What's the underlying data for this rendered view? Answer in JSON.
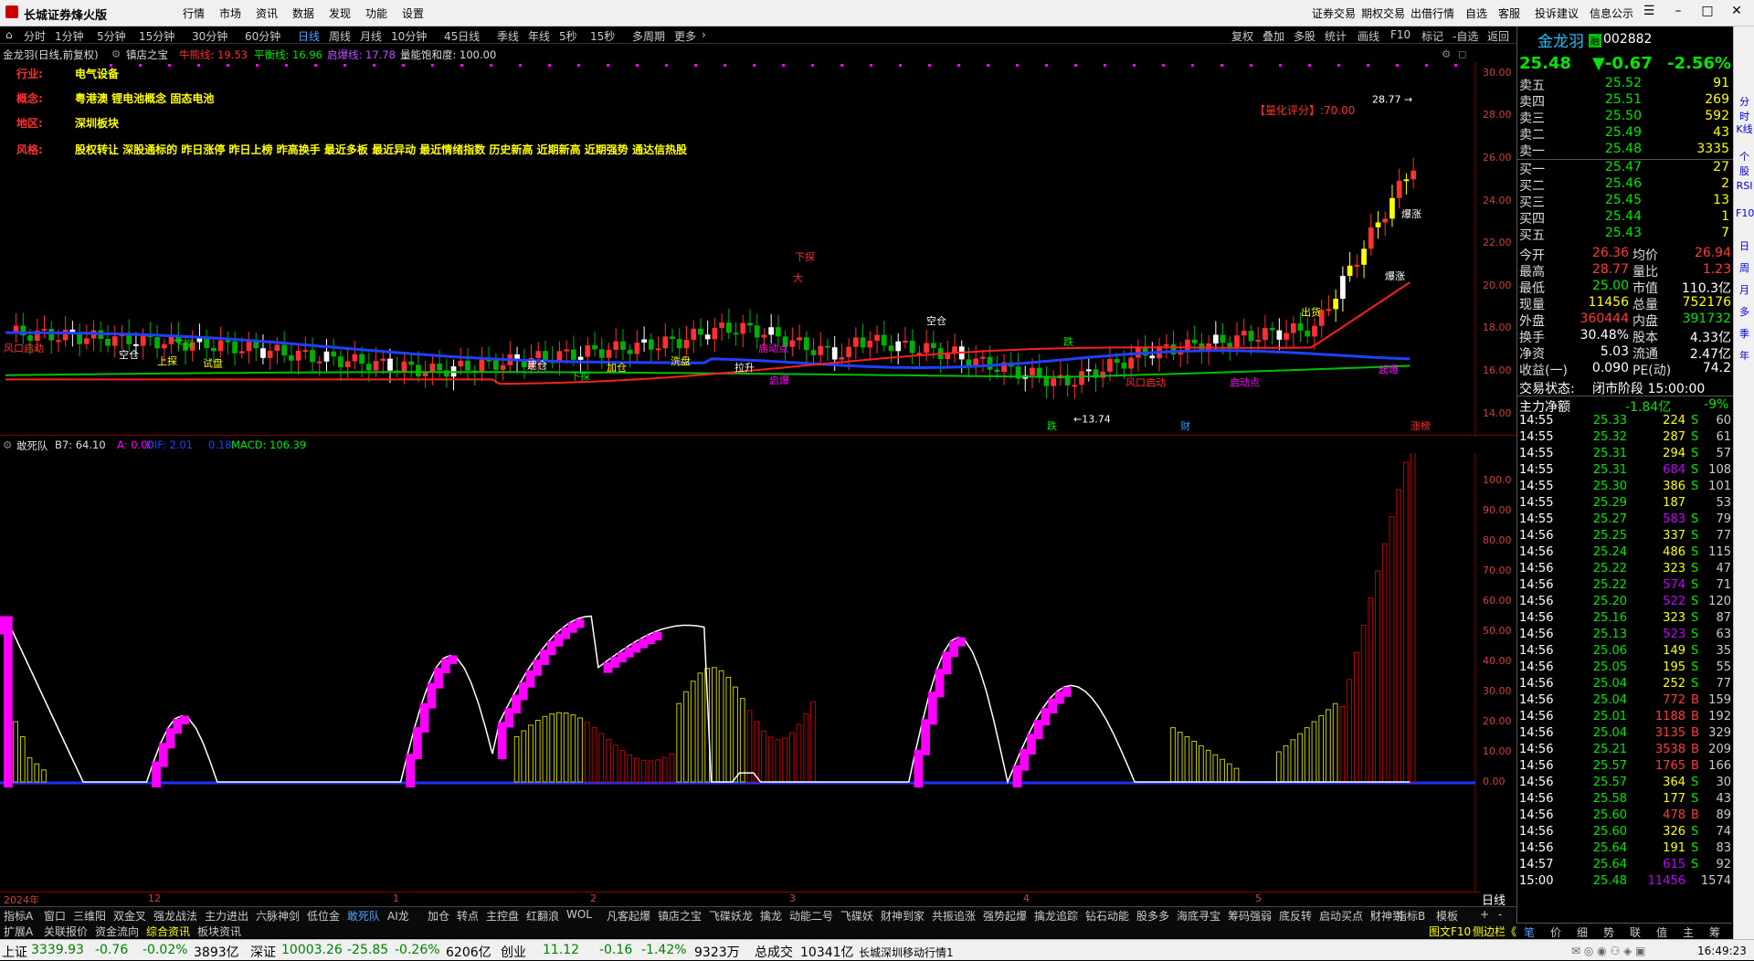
{
  "app": {
    "title": "长城证券烽火版"
  },
  "menu": [
    "行情",
    "市场",
    "资讯",
    "数据",
    "发现",
    "功能",
    "设置"
  ],
  "rightmenu": [
    "证券交易",
    "期权交易",
    "出借行情",
    "自选",
    "客服",
    "投诉建议",
    "信息公示"
  ],
  "periods": [
    "分时",
    "1分钟",
    "5分钟",
    "15分钟",
    "30分钟",
    "60分钟",
    "日线",
    "周线",
    "月线",
    "10分钟",
    "45日线",
    "季线",
    "年线",
    "5秒",
    "15秒",
    "多周期",
    "更多"
  ],
  "active_period": "日线",
  "tools": [
    "复权",
    "叠加",
    "多股",
    "统计",
    "画线",
    "F10",
    "标记",
    "-自选",
    "返回"
  ],
  "chart_header": {
    "name": "金龙羽(日线,前复权)",
    "indicator": "镇店之宝",
    "bull_label": "牛熊线: 19.53",
    "balance_label": "平衡线: 16.96",
    "launch_label": "启爆线: 17.78",
    "energy_label": "量能饱和度: 100.00"
  },
  "info": {
    "industry_label": "行业:",
    "industry": "电气设备",
    "concept_label": "概念:",
    "concept": "粤港澳 锂电池概念 固态电池",
    "region_label": "地区:",
    "region": "深圳板块",
    "style_label": "风格:",
    "style": "股权转让 深股通标的 昨日涨停 昨日上榜 昨高换手 最近多板 最近异动 最近情绪指数 历史新高 近期新高 近期强势 通达信热股"
  },
  "quant_score": "【量化评分】:70.00",
  "price_high_label": "28.77",
  "price_low_label": "13.74",
  "price_axis": [
    "30.00",
    "28.00",
    "26.00",
    "24.00",
    "22.00",
    "20.00",
    "18.00",
    "16.00",
    "14.00"
  ],
  "macd_header": {
    "name": "敢死队",
    "b7": "B7: 64.10",
    "a": "A: 0.00",
    "dif": "DIF: 2.01",
    "dea": "0.18",
    "macd": "MACD: 106.39"
  },
  "sub_axis": [
    "100.0",
    "90.00",
    "80.00",
    "70.00",
    "60.00",
    "50.00",
    "40.00",
    "30.00",
    "20.00",
    "10.00",
    "0.00"
  ],
  "date_axis": [
    "2024年",
    "12",
    "1",
    "2",
    "3",
    "4",
    "5"
  ],
  "event_marks": [
    "跌",
    "财",
    "涨榜"
  ],
  "chart_annotations": [
    "风口启动",
    "空仓",
    "上探",
    "下探",
    "试盘",
    "建仓",
    "下探",
    "加仓",
    "洗盘",
    "拉升",
    "启动点",
    "启爆",
    "下探",
    "风口启动",
    "启动点",
    "起爆",
    "爆涨",
    "爆涨",
    "出货",
    "大",
    "跌",
    "空仓"
  ],
  "quote": {
    "name": "金龙羽",
    "tag": "融",
    "code": "002882",
    "price": "25.48",
    "change": "▼-0.67",
    "pct": "-2.56%"
  },
  "orderbook": {
    "asks": [
      {
        "label": "卖五",
        "price": "25.52",
        "vol": "91"
      },
      {
        "label": "卖四",
        "price": "25.51",
        "vol": "269"
      },
      {
        "label": "卖三",
        "price": "25.50",
        "vol": "592"
      },
      {
        "label": "卖二",
        "price": "25.49",
        "vol": "43"
      },
      {
        "label": "卖一",
        "price": "25.48",
        "vol": "3335"
      }
    ],
    "bids": [
      {
        "label": "买一",
        "price": "25.47",
        "vol": "27"
      },
      {
        "label": "买二",
        "price": "25.46",
        "vol": "2"
      },
      {
        "label": "买三",
        "price": "25.45",
        "vol": "13"
      },
      {
        "label": "买四",
        "price": "25.44",
        "vol": "1"
      },
      {
        "label": "买五",
        "price": "25.43",
        "vol": "7"
      }
    ]
  },
  "stats": [
    {
      "l1": "今开",
      "v1": "26.36",
      "c1": "red",
      "l2": "均价",
      "v2": "26.94",
      "c2": "red"
    },
    {
      "l1": "最高",
      "v1": "28.77",
      "c1": "red",
      "l2": "量比",
      "v2": "1.23",
      "c2": "red"
    },
    {
      "l1": "最低",
      "v1": "25.00",
      "c1": "green",
      "l2": "市值",
      "v2": "110.3亿",
      "c2": "white"
    },
    {
      "l1": "现量",
      "v1": "11456",
      "c1": "yellow",
      "l2": "总量",
      "v2": "752176",
      "c2": "yellow"
    },
    {
      "l1": "外盘",
      "v1": "360444",
      "c1": "red",
      "l2": "内盘",
      "v2": "391732",
      "c2": "green"
    },
    {
      "l1": "换手",
      "v1": "30.48%",
      "c1": "white",
      "l2": "股本",
      "v2": "4.33亿",
      "c2": "white"
    },
    {
      "l1": "净资",
      "v1": "5.03",
      "c1": "white",
      "l2": "流通",
      "v2": "2.47亿",
      "c2": "white"
    },
    {
      "l1": "收益(一)",
      "v1": "0.090",
      "c1": "white",
      "l2": "PE(动)",
      "v2": "74.2",
      "c2": "white"
    }
  ],
  "trade_status": {
    "label": "交易状态:",
    "value": "闭市阶段 15:00:00"
  },
  "main_net": {
    "label": "主力净额",
    "value": "-1.84亿",
    "pct": "-9%"
  },
  "ticks": [
    {
      "t": "14:55",
      "p": "25.33",
      "v": "224",
      "bs": "S",
      "n": "60"
    },
    {
      "t": "14:55",
      "p": "25.32",
      "v": "287",
      "bs": "S",
      "n": "61"
    },
    {
      "t": "14:55",
      "p": "25.31",
      "v": "294",
      "bs": "S",
      "n": "57"
    },
    {
      "t": "14:55",
      "p": "25.31",
      "v": "684",
      "bs": "S",
      "n": "108"
    },
    {
      "t": "14:55",
      "p": "25.30",
      "v": "386",
      "bs": "S",
      "n": "101"
    },
    {
      "t": "14:55",
      "p": "25.29",
      "v": "187",
      "bs": "",
      "n": "53"
    },
    {
      "t": "14:55",
      "p": "25.27",
      "v": "583",
      "bs": "S",
      "n": "79"
    },
    {
      "t": "14:56",
      "p": "25.25",
      "v": "337",
      "bs": "S",
      "n": "77"
    },
    {
      "t": "14:56",
      "p": "25.24",
      "v": "486",
      "bs": "S",
      "n": "115"
    },
    {
      "t": "14:56",
      "p": "25.22",
      "v": "323",
      "bs": "S",
      "n": "47"
    },
    {
      "t": "14:56",
      "p": "25.22",
      "v": "574",
      "bs": "S",
      "n": "71"
    },
    {
      "t": "14:56",
      "p": "25.20",
      "v": "522",
      "bs": "S",
      "n": "120"
    },
    {
      "t": "14:56",
      "p": "25.16",
      "v": "323",
      "bs": "S",
      "n": "87"
    },
    {
      "t": "14:56",
      "p": "25.13",
      "v": "523",
      "bs": "S",
      "n": "63"
    },
    {
      "t": "14:56",
      "p": "25.06",
      "v": "149",
      "bs": "S",
      "n": "35"
    },
    {
      "t": "14:56",
      "p": "25.05",
      "v": "195",
      "bs": "S",
      "n": "55"
    },
    {
      "t": "14:56",
      "p": "25.04",
      "v": "252",
      "bs": "S",
      "n": "77"
    },
    {
      "t": "14:56",
      "p": "25.04",
      "v": "772",
      "bs": "B",
      "n": "159"
    },
    {
      "t": "14:56",
      "p": "25.01",
      "v": "1188",
      "bs": "B",
      "n": "192"
    },
    {
      "t": "14:56",
      "p": "25.04",
      "v": "3135",
      "bs": "B",
      "n": "329"
    },
    {
      "t": "14:56",
      "p": "25.21",
      "v": "3538",
      "bs": "B",
      "n": "209"
    },
    {
      "t": "14:56",
      "p": "25.57",
      "v": "1765",
      "bs": "B",
      "n": "166"
    },
    {
      "t": "14:56",
      "p": "25.57",
      "v": "364",
      "bs": "S",
      "n": "30"
    },
    {
      "t": "14:56",
      "p": "25.58",
      "v": "177",
      "bs": "S",
      "n": "43"
    },
    {
      "t": "14:56",
      "p": "25.60",
      "v": "478",
      "bs": "B",
      "n": "89"
    },
    {
      "t": "14:56",
      "p": "25.60",
      "v": "326",
      "bs": "S",
      "n": "74"
    },
    {
      "t": "14:56",
      "p": "25.64",
      "v": "191",
      "bs": "S",
      "n": "83"
    },
    {
      "t": "14:57",
      "p": "25.64",
      "v": "615",
      "bs": "S",
      "n": "92"
    },
    {
      "t": "15:00",
      "p": "25.48",
      "v": "11456",
      "bs": "",
      "n": "1574"
    }
  ],
  "tabs": [
    "指标A",
    "窗口",
    "三维阳",
    "双金叉",
    "强龙战法",
    "主力进出",
    "六脉神剑",
    "低位金",
    "敢死队",
    "AI龙",
    "加仓",
    "转点",
    "主控盘",
    "红翻浪",
    "WOL",
    "凡客起爆",
    "镇店之宝",
    "飞碟妖龙",
    "擒龙",
    "动能二号",
    "飞碟妖",
    "财神到家",
    "共振追涨",
    "强势起爆",
    "擒龙追踪",
    "钻石动能",
    "股多多",
    "海底寻宝",
    "筹码强弱",
    "底反转",
    "启动买点",
    "财神到"
  ],
  "active_tab": "敢死队",
  "tabs_right": [
    "指标B",
    "模板",
    "+",
    "-"
  ],
  "tabs2": [
    "扩展A",
    "关联报价",
    "资金流向",
    "综合资讯",
    "板块资讯"
  ],
  "tabs2_right": [
    "图文F10",
    "侧边栏《"
  ],
  "period_badge": "日线",
  "right_tabs": [
    "笔",
    "价",
    "细",
    "势",
    "联",
    "值",
    "主",
    "筹"
  ],
  "sidebar": [
    "分时",
    "K线",
    "个股",
    "RSI",
    "F10",
    "日",
    "周",
    "月",
    "多",
    "季",
    "年"
  ],
  "status": {
    "sh_label": "上证",
    "sh": "3339.93",
    "sh_chg": "-0.76",
    "sh_pct": "-0.02%",
    "sh_amt": "3893亿",
    "sz_label": "深证",
    "sz": "10003.26",
    "sz_chg": "-25.85",
    "sz_pct": "-0.26%",
    "sz_amt": "6206亿",
    "cy_label": "创业",
    "cy": "11.12",
    "cy_chg": "-0.16",
    "cy_pct": "-1.42%",
    "cy_amt": "9323万",
    "total_label": "总成交",
    "total": "10341亿",
    "feed": "长城深圳移动行情1",
    "time": "16:49:23"
  },
  "chart_data": {
    "type": "candlestick",
    "price_range": [
      13,
      30.5
    ],
    "high": 28.77,
    "low": 13.74,
    "last": 25.48,
    "lines": {
      "bull_bear": 19.53,
      "balance": 16.96,
      "launch": 17.78
    },
    "sub_range": [
      0,
      106
    ],
    "sub_series": [
      "B7",
      "A",
      "DIF",
      "DEA",
      "MACD"
    ]
  }
}
